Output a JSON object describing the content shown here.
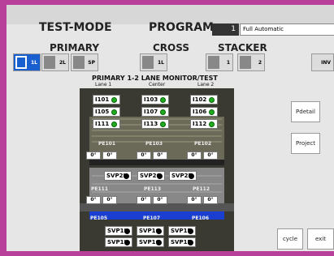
{
  "header": {
    "mode": "TEST-MODE",
    "program_label": "PROGRAM",
    "program_number": "1",
    "program_name": "Full Automatic"
  },
  "sections": {
    "primary": "PRIMARY",
    "cross": "CROSS",
    "stacker": "STACKER"
  },
  "toolbar": {
    "primary_1l": "1L",
    "primary_2l": "2L",
    "primary_sp": "SP",
    "cross_1l": "1L",
    "stacker_1": "1",
    "stacker_2": "2",
    "inv": "INV"
  },
  "monitor": {
    "title": "PRIMARY 1-2 LANE MONITOR/TEST",
    "lane1": "Lane 1",
    "center": "Center",
    "lane2": "Lane 2",
    "sensors": [
      "I101",
      "I103",
      "I102",
      "I105",
      "I107",
      "I106",
      "I111",
      "I113",
      "I112"
    ],
    "pe_top": [
      "PE101",
      "PE103",
      "PE102"
    ],
    "deg": [
      "0°",
      "0°",
      "0°",
      "0°",
      "0°",
      "0°"
    ],
    "svp_mid": [
      "SVP2L",
      "SVP2C",
      "SVP2R"
    ],
    "pe_mid": [
      "PE111",
      "PE113",
      "PE112"
    ],
    "deg2": [
      "0°",
      "0°",
      "0°",
      "0°",
      "0°",
      "0°"
    ],
    "pe_bot": [
      "PE105",
      "PE107",
      "PE106"
    ],
    "svp_low1": [
      "SVP1L",
      "SVP1C",
      "SVP1R"
    ],
    "svp_low2": [
      "SVP1L",
      "SVP1C",
      "SVP1R"
    ]
  },
  "side": {
    "pdetail": "Pdetail",
    "project": "Project",
    "cycle": "cycle",
    "exit": "exit"
  }
}
